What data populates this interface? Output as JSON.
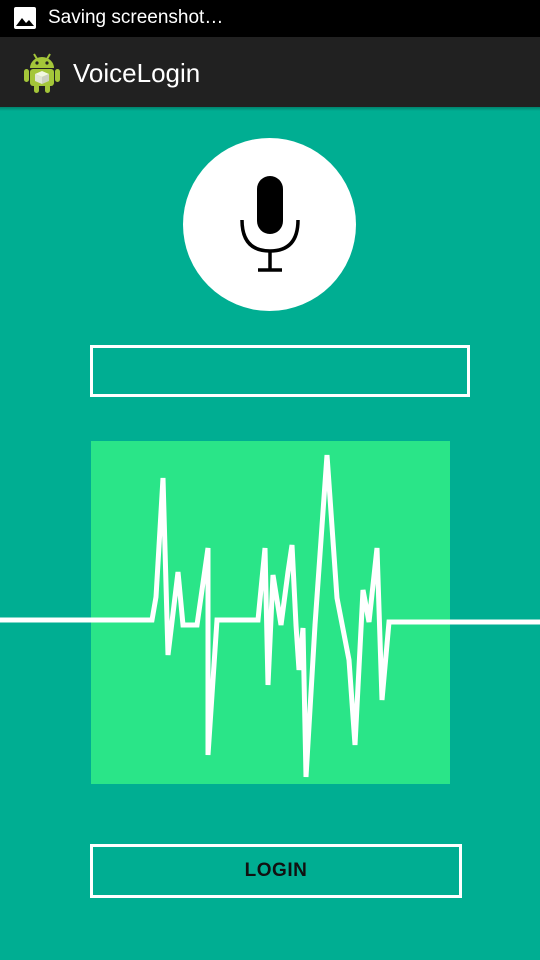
{
  "status_bar": {
    "notification_text": "Saving screenshot…",
    "icon": "image-icon"
  },
  "app_bar": {
    "title": "VoiceLogin",
    "icon": "android-icon"
  },
  "mic": {
    "icon": "microphone-icon"
  },
  "voice_text_field": {
    "value": "",
    "placeholder": ""
  },
  "waveform": {
    "icon": "voice-waveform"
  },
  "login_button": {
    "label": "LOGIN"
  },
  "colors": {
    "background": "#00AE92",
    "wave_panel": "#2AE588",
    "app_bar": "#212121",
    "status_bar": "#000000",
    "accent": "#FFFFFF"
  }
}
